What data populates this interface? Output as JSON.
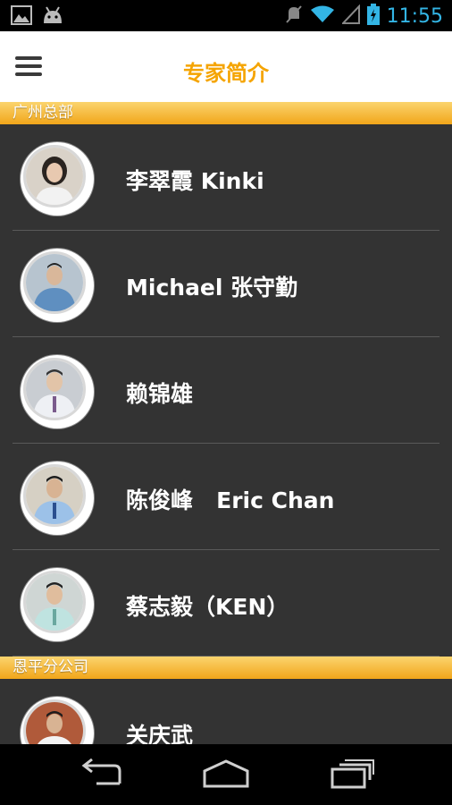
{
  "status_bar": {
    "time": "11:55",
    "accent_color": "#33b5e5",
    "icons": [
      "gallery-icon",
      "android-icon",
      "mute-icon",
      "wifi-icon",
      "signal-icon",
      "battery-icon"
    ]
  },
  "header": {
    "title": "专家简介",
    "title_color": "#f5a400",
    "menu_icon": "hamburger-menu-icon"
  },
  "sections": [
    {
      "title": "广州总部",
      "items": [
        {
          "name": "李翠霞 Kinki"
        },
        {
          "name": "Michael 张守勤"
        },
        {
          "name": "赖锦雄"
        },
        {
          "name": "陈俊峰   Eric Chan"
        },
        {
          "name": "蔡志毅（KEN）"
        }
      ]
    },
    {
      "title": "恩平分公司",
      "items": [
        {
          "name": "关庆武"
        }
      ]
    }
  ],
  "nav_bar": {
    "buttons": [
      "back-icon",
      "home-icon",
      "recent-apps-icon"
    ]
  },
  "colors": {
    "list_bg": "#333333",
    "section_gradient_top": "#fbd46e",
    "section_gradient_bottom": "#f1a61a"
  }
}
